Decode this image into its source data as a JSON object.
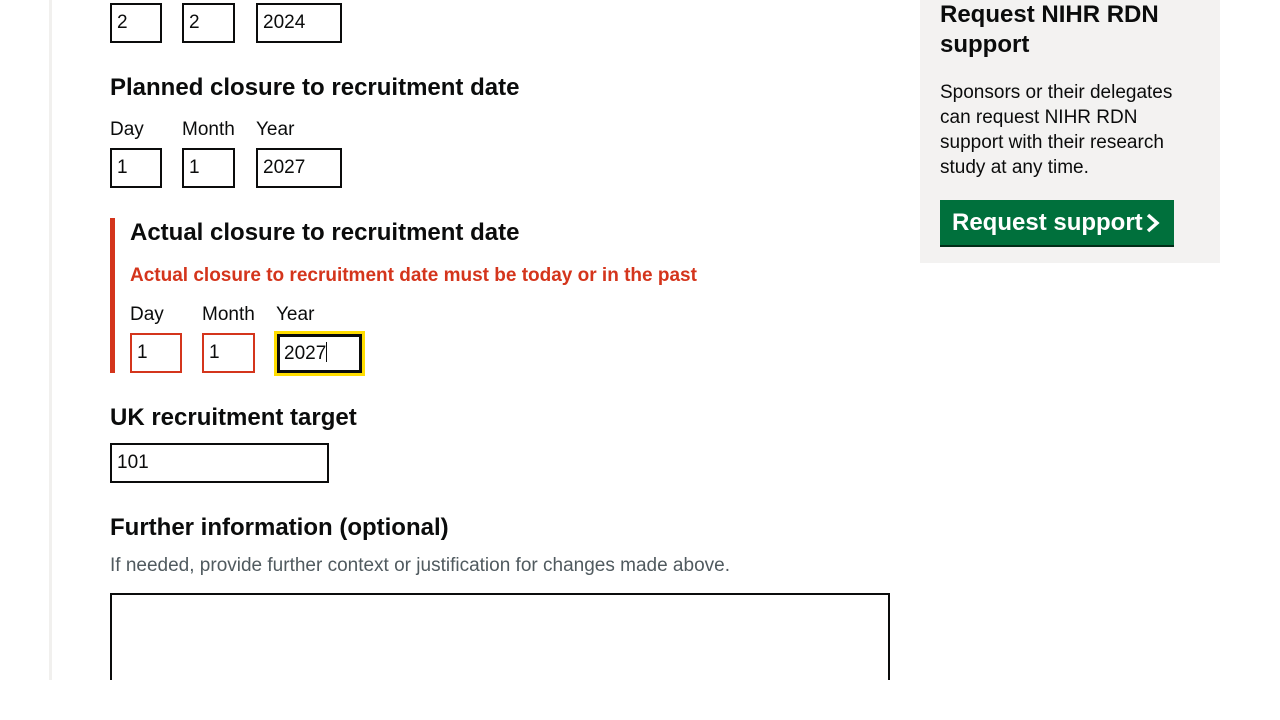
{
  "form": {
    "start_date": {
      "day": "2",
      "month": "2",
      "year": "2024"
    },
    "planned_closure": {
      "heading": "Planned closure to recruitment date",
      "day_label": "Day",
      "month_label": "Month",
      "year_label": "Year",
      "day": "1",
      "month": "1",
      "year": "2027"
    },
    "actual_closure": {
      "heading": "Actual closure to recruitment date",
      "error": "Actual closure to recruitment date must be today or in the past",
      "day_label": "Day",
      "month_label": "Month",
      "year_label": "Year",
      "day": "1",
      "month": "1",
      "year": "2027"
    },
    "uk_target": {
      "heading": "UK recruitment target",
      "value": "101"
    },
    "further_info": {
      "heading": "Further information (optional)",
      "hint": "If needed, provide further context or justification for changes made above.",
      "value": ""
    }
  },
  "sidebar": {
    "title": "Request NIHR RDN support",
    "body": "Sponsors or their delegates can request NIHR RDN support with their research study at any time.",
    "button_label": "Request support",
    "button_icon": "chevron-right-icon"
  },
  "colors": {
    "error": "#d4351c",
    "focus": "#ffdd00",
    "button": "#00703c",
    "sidebar_bg": "#f3f2f1",
    "hint": "#505a5f"
  }
}
